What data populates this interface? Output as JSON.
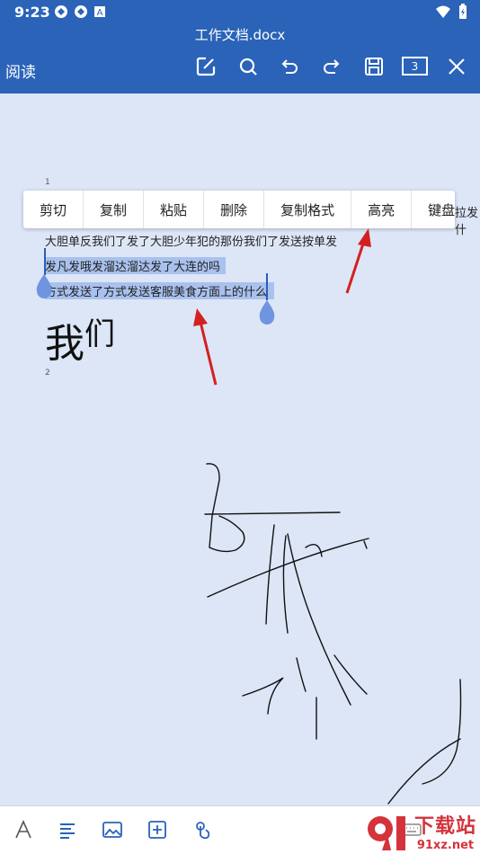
{
  "status_bar": {
    "time": "9:23"
  },
  "header": {
    "doc_title": "工作文档.docx",
    "mode_label": "阅读",
    "page_count": "3"
  },
  "document": {
    "page1_number": "1",
    "page2_number": "2",
    "lines": [
      "大胆单反我们了发了大胆少年犯的那份我们了发送按单发",
      "发凡发哦发溜达溜达发了大连的吗",
      "方式发送了方式发送客服美食方面上的什么"
    ],
    "big_text_main": "我",
    "big_text_sup": "们",
    "overflow_text": "拉发什"
  },
  "context_menu": {
    "items": [
      "剪切",
      "复制",
      "粘贴",
      "删除",
      "复制格式",
      "高亮",
      "键盘"
    ]
  },
  "watermark": {
    "brand": "下载站",
    "url": "91xz.net"
  },
  "colors": {
    "header_bg": "#2a63b8",
    "page_bg": "#dce6f7",
    "selection": "#a9c1ee",
    "arrow": "#d42020"
  }
}
